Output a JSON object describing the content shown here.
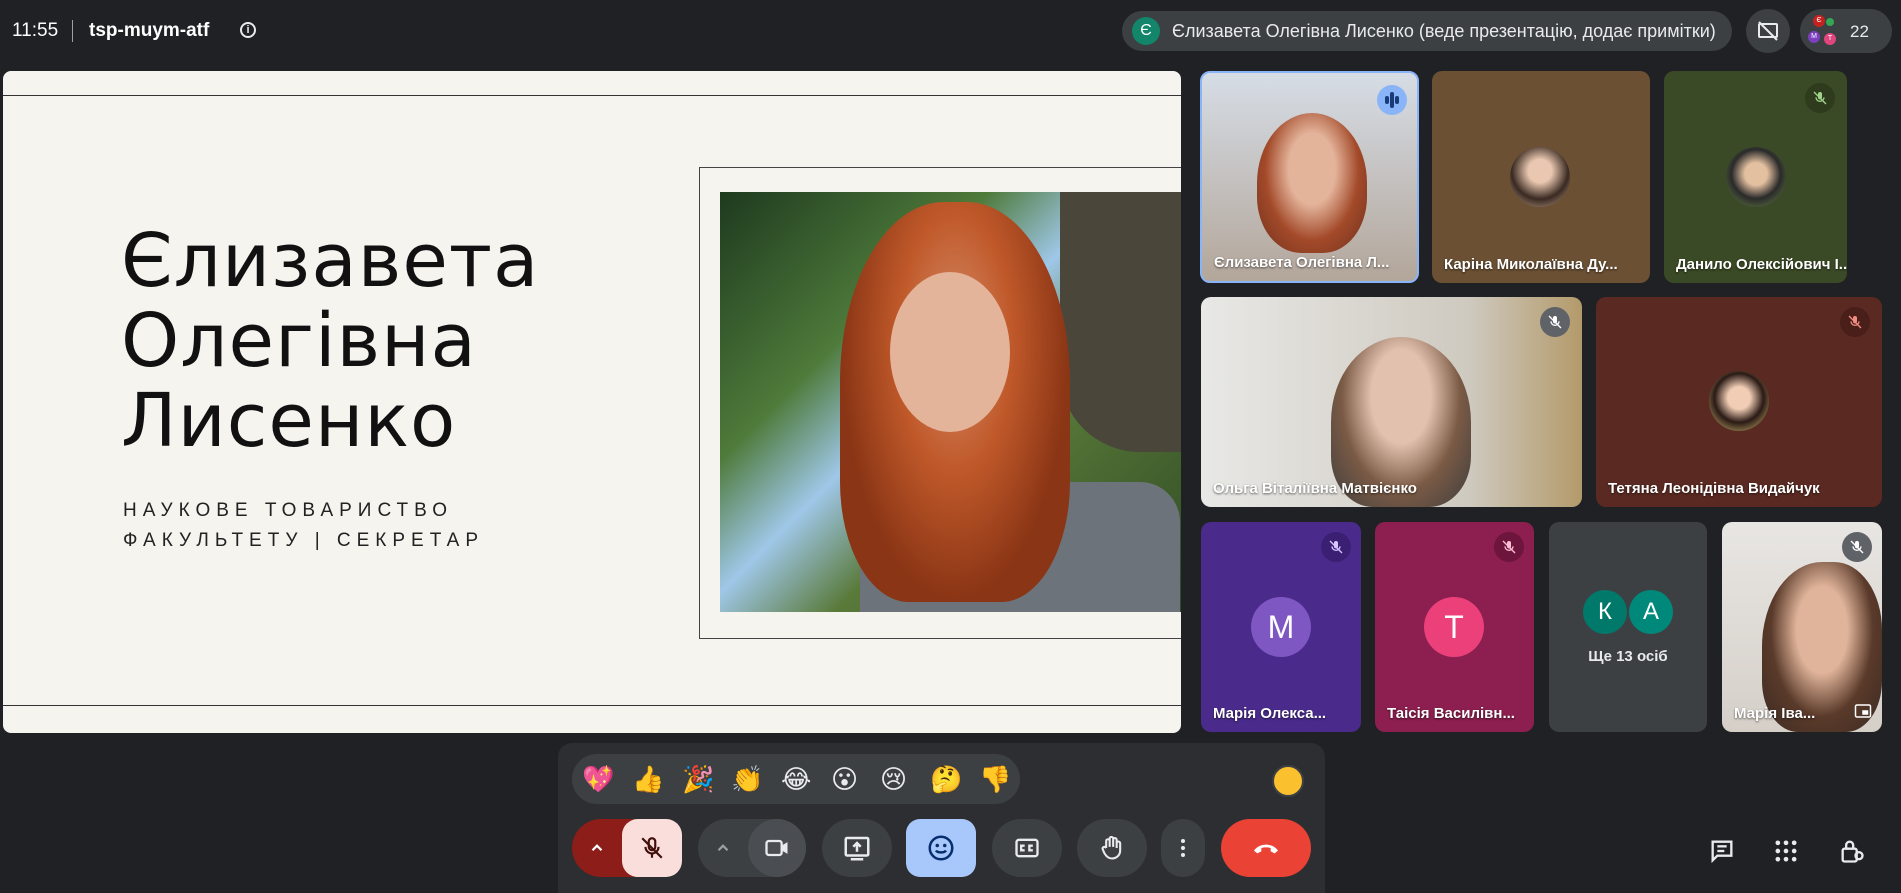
{
  "header": {
    "time": "11:55",
    "meeting_code": "tsp-muym-atf",
    "presenter_initial": "Є",
    "presenter_text": "Єлизавета Олегівна Лисенко (веде презентацію, додає примітки)",
    "participant_count": "22",
    "mini_avatars": [
      "Є",
      "М",
      "Т"
    ]
  },
  "slide": {
    "name_line1": "Єлизавета",
    "name_line2": "Олегівна",
    "name_line3": "Лисенко",
    "subtitle_line1": "НАУКОВЕ ТОВАРИСТВО",
    "subtitle_line2": "ФАКУЛЬТЕТУ | СЕКРЕТАР"
  },
  "participants": [
    {
      "name": "Єлизавета Олегівна Л...",
      "state": "speaking"
    },
    {
      "name": "Каріна Миколаївна Ду...",
      "state": "photo"
    },
    {
      "name": "Данило Олексійович І...",
      "state": "muted"
    },
    {
      "name": "Ольга Віталіївна Матвієнко",
      "state": "muted"
    },
    {
      "name": "Тетяна Леонідівна Видайчук",
      "state": "muted"
    },
    {
      "name": "Марія Олекса...",
      "initial": "М",
      "state": "muted"
    },
    {
      "name": "Таісія Василівн...",
      "initial": "Т",
      "state": "muted"
    },
    {
      "name": "Марія Іва...",
      "state": "muted"
    }
  ],
  "others": {
    "initials": [
      "К",
      "А"
    ],
    "label": "Ще 13 осіб"
  },
  "reactions": [
    "💖",
    "👍",
    "🎉",
    "👏",
    "😂",
    "😮",
    "😢",
    "🤔",
    "👎"
  ],
  "colors": {
    "background": "#202124",
    "leave": "#ea4335",
    "emoji_active": "#a8c7fa",
    "mic_off_bg": "#f9dedc",
    "speaking": "#8ab4f8"
  }
}
